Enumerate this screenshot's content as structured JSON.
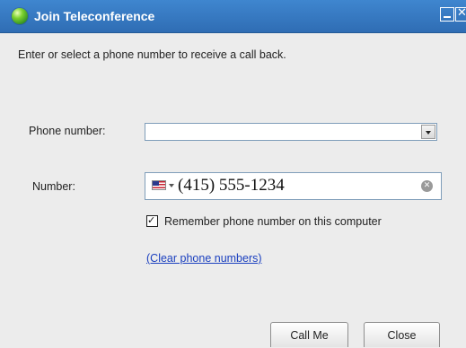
{
  "window": {
    "title": "Join Teleconference",
    "accent_color": "#3a7dc6"
  },
  "dialog": {
    "instruction": "Enter or select a phone number to receive a call back.",
    "phone_number_label": "Phone number:",
    "phone_number_dropdown_value": "",
    "number_label": "Number:",
    "number_value": "(415) 555-1234",
    "country_flag": "us-flag-icon",
    "remember_checked": true,
    "remember_label": "Remember phone number on this computer",
    "clear_link": "(Clear phone numbers)",
    "call_button": "Call Me",
    "close_button": "Close"
  },
  "icons": {
    "app": "globe-icon",
    "minimize": "minimize-icon",
    "close": "close-icon",
    "clear": "clear-icon",
    "dropdown": "chevron-down-icon"
  }
}
